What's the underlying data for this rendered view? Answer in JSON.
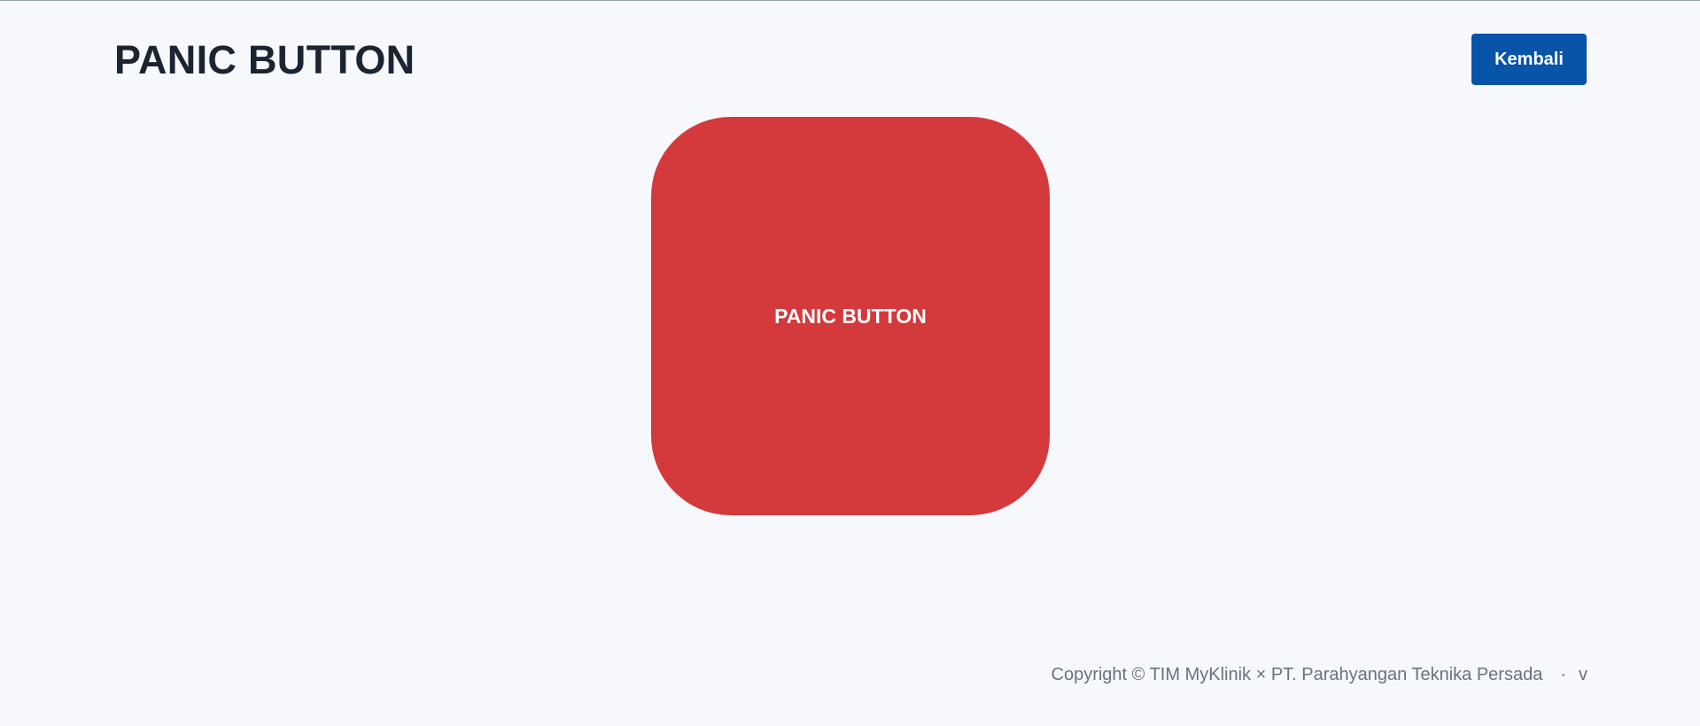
{
  "header": {
    "title": "PANIC BUTTON",
    "back_label": "Kembali"
  },
  "main": {
    "panic_label": "PANIC BUTTON"
  },
  "footer": {
    "copyright": "Copyright © TIM MyKlinik × PT. Parahyangan Teknika Persada",
    "separator": "·",
    "version": "v"
  },
  "colors": {
    "background": "#f6f8fb",
    "title": "#1b2431",
    "back_button": "#0754a8",
    "panic_button": "#d4393b",
    "footer_text": "#667380"
  }
}
